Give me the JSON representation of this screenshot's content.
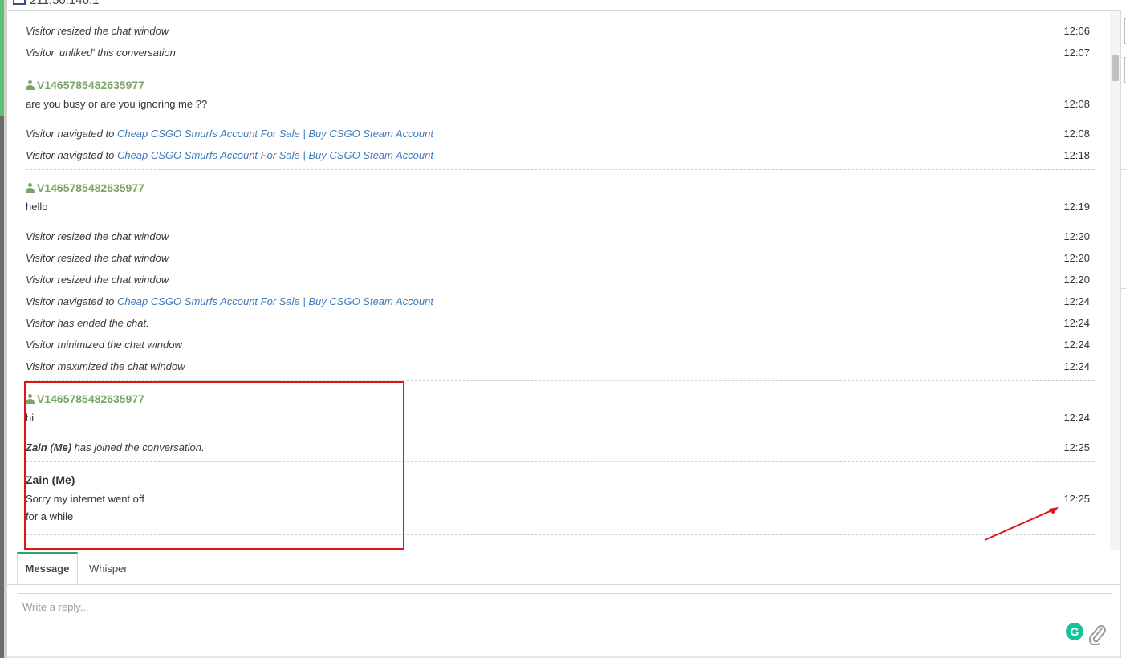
{
  "window": {
    "title": "211.50.146.1"
  },
  "events": [
    {
      "text": "Visitor resized the chat window",
      "time": "12:06"
    },
    {
      "text": "Visitor 'unliked' this conversation",
      "time": "12:07"
    }
  ],
  "groups": [
    {
      "sender": "V1465785482635977",
      "message": "are you busy or are you ignoring me ??",
      "message_time": "12:08",
      "events": [
        {
          "prefix": "Visitor navigated to ",
          "link": "Cheap CSGO Smurfs Account For Sale | Buy CSGO Steam Account",
          "time": "12:08"
        },
        {
          "prefix": "Visitor navigated to ",
          "link": "Cheap CSGO Smurfs Account For Sale | Buy CSGO Steam Account",
          "time": "12:18"
        }
      ]
    },
    {
      "sender": "V1465785482635977",
      "message": "hello",
      "message_time": "12:19",
      "events": [
        {
          "text": "Visitor resized the chat window",
          "time": "12:20"
        },
        {
          "text": "Visitor resized the chat window",
          "time": "12:20"
        },
        {
          "text": "Visitor resized the chat window",
          "time": "12:20"
        },
        {
          "prefix": "Visitor navigated to ",
          "link": "Cheap CSGO Smurfs Account For Sale | Buy CSGO Steam Account",
          "time": "12:24"
        },
        {
          "text": "Visitor has ended the chat.",
          "time": "12:24"
        },
        {
          "text": "Visitor minimized the chat window",
          "time": "12:24"
        },
        {
          "text": "Visitor maximized the chat window",
          "time": "12:24"
        }
      ]
    },
    {
      "sender": "V1465785482635977",
      "message": "hi",
      "message_time": "12:24",
      "joined": {
        "name": "Zain (Me)",
        "rest": " has joined the conversation.",
        "time": "12:25"
      }
    }
  ],
  "agent_message": {
    "sender": "Zain (Me)",
    "lines": [
      "Sorry my internet went off",
      "for a while"
    ],
    "time": "12:25"
  },
  "tabs": {
    "message": "Message",
    "whisper": "Whisper"
  },
  "reply": {
    "placeholder": "Write a reply...",
    "grammarly_letter": "G"
  },
  "colors": {
    "sender": "#7aa567",
    "link": "#3f7ab8",
    "highlight": "#e01414",
    "tab_accent": "#2fa36b"
  }
}
